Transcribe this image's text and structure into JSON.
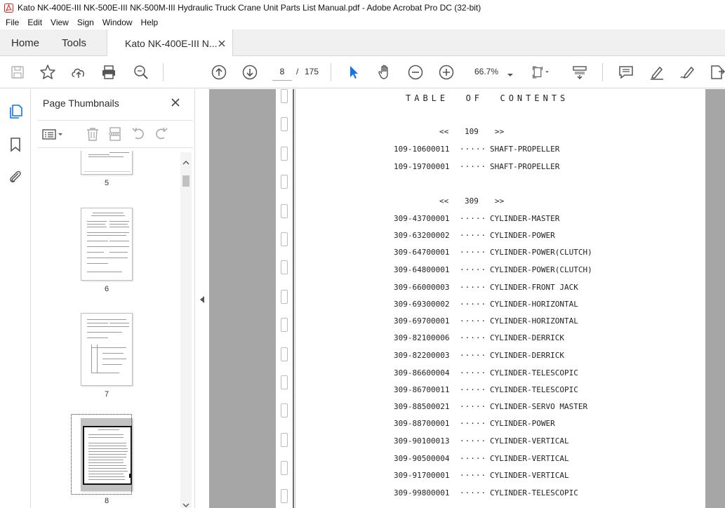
{
  "window": {
    "title": "Kato NK-400E-III NK-500E-III NK-500M-III Hydraulic Truck Crane Unit Parts List Manual.pdf - Adobe Acrobat Pro DC (32-bit)",
    "app_icon": "acrobat-icon"
  },
  "menu": {
    "items": [
      "File",
      "Edit",
      "View",
      "Sign",
      "Window",
      "Help"
    ]
  },
  "tabs": {
    "home": "Home",
    "tools": "Tools",
    "document": "Kato NK-400E-III N..."
  },
  "toolbar": {
    "current_page": "8",
    "page_separator": "/",
    "total_pages": "175",
    "zoom": "66.7%",
    "icons": [
      "save-icon",
      "star-icon",
      "upload-icon",
      "print-icon",
      "zoom-search-icon",
      "page-up-icon",
      "page-down-icon",
      "select-cursor-icon",
      "hand-icon",
      "zoom-out-icon",
      "zoom-in-icon",
      "page-fit-icon",
      "scroll-mode-icon",
      "comment-icon",
      "highlight-icon",
      "sign-icon",
      "export-icon"
    ]
  },
  "thumbnails": {
    "title": "Page Thumbnails",
    "pages": [
      {
        "label": "5"
      },
      {
        "label": "6"
      },
      {
        "label": "7"
      },
      {
        "label": "8"
      }
    ],
    "selected_page": "8"
  },
  "document": {
    "toc_title": "TABLE  OF  CONTENTS",
    "sections": [
      {
        "heading_left": "<<",
        "heading_num": "109",
        "heading_right": ">>",
        "entries": [
          {
            "code": "109-10600011",
            "dots": "·····",
            "name": "SHAFT-PROPELLER"
          },
          {
            "code": "109-19700001",
            "dots": "·····",
            "name": "SHAFT-PROPELLER"
          }
        ]
      },
      {
        "heading_left": "<<",
        "heading_num": "309",
        "heading_right": ">>",
        "entries": [
          {
            "code": "309-43700001",
            "dots": "·····",
            "name": "CYLINDER-MASTER"
          },
          {
            "code": "309-63200002",
            "dots": "·····",
            "name": "CYLINDER-POWER"
          },
          {
            "code": "309-64700001",
            "dots": "·····",
            "name": "CYLINDER-POWER(CLUTCH)"
          },
          {
            "code": "309-64800001",
            "dots": "·····",
            "name": "CYLINDER-POWER(CLUTCH)"
          },
          {
            "code": "309-66000003",
            "dots": "·····",
            "name": "CYLINDER-FRONT JACK"
          },
          {
            "code": "309-69300002",
            "dots": "·····",
            "name": "CYLINDER-HORIZONTAL"
          },
          {
            "code": "309-69700001",
            "dots": "·····",
            "name": "CYLINDER-HORIZONTAL"
          },
          {
            "code": "309-82100006",
            "dots": "·····",
            "name": "CYLINDER-DERRICK"
          },
          {
            "code": "309-82200003",
            "dots": "·····",
            "name": "CYLINDER-DERRICK"
          },
          {
            "code": "309-86600004",
            "dots": "·····",
            "name": "CYLINDER-TELESCOPIC"
          },
          {
            "code": "309-86700011",
            "dots": "·····",
            "name": "CYLINDER-TELESCOPIC"
          },
          {
            "code": "309-88500021",
            "dots": "·····",
            "name": "CYLINDER-SERVO MASTER"
          },
          {
            "code": "309-88700001",
            "dots": "·····",
            "name": "CYLINDER-POWER"
          },
          {
            "code": "309-90100013",
            "dots": "·····",
            "name": "CYLINDER-VERTICAL"
          },
          {
            "code": "309-90500004",
            "dots": "·····",
            "name": "CYLINDER-VERTICAL"
          },
          {
            "code": "309-91700001",
            "dots": "·····",
            "name": "CYLINDER-VERTICAL"
          },
          {
            "code": "309-99800001",
            "dots": "·····",
            "name": "CYLINDER-TELESCOPIC"
          }
        ]
      }
    ]
  },
  "colors": {
    "acrobat_red": "#d7261e",
    "select_blue": "#1473e6",
    "doc_bg": "#a6a6a6"
  }
}
